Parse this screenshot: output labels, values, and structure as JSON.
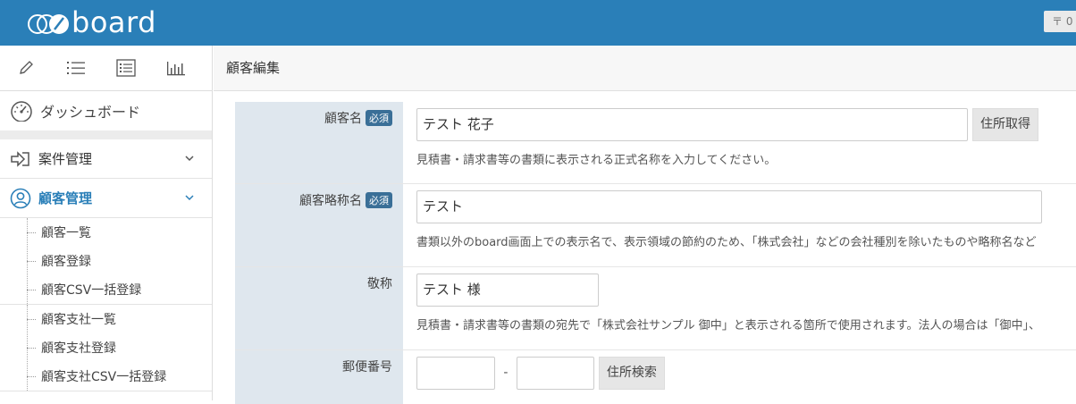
{
  "header": {
    "logo_text": "board",
    "notif_label": "〒 0"
  },
  "sidebar": {
    "toolbar_icons": [
      "pencil-icon",
      "list-icon",
      "list-box-icon",
      "chart-icon"
    ],
    "dashboard_label": "ダッシュボード",
    "case_menu_label": "案件管理",
    "customer_menu_label": "顧客管理",
    "customer_items": [
      "顧客一覧",
      "顧客登録",
      "顧客CSV一括登録"
    ],
    "payer_items": [
      "顧客支社一覧",
      "顧客支社登録",
      "顧客支社CSV一括登録"
    ]
  },
  "main": {
    "title": "顧客編集",
    "required_badge": "必須",
    "fields": {
      "name": {
        "label": "顧客名",
        "value": "テスト 花子",
        "button": "住所取得",
        "help": "見積書・請求書等の書類に表示される正式名称を入力してください。"
      },
      "short_name": {
        "label": "顧客略称名",
        "value": "テスト",
        "help": "書類以外のboard画面上での表示名で、表示領域の節約のため、「株式会社」などの会社種別を除いたものや略称名など"
      },
      "honorific": {
        "label": "敬称",
        "value": "テスト 様",
        "help": "見積書・請求書等の書類の宛先で「株式会社サンプル 御中」と表示される箇所で使用されます。法人の場合は「御中」、"
      },
      "postal": {
        "label": "郵便番号",
        "value1": "",
        "separator": "-",
        "value2": "",
        "button": "住所検索"
      }
    }
  },
  "colors": {
    "header_bg": "#2a7fb8",
    "label_bg": "#dfe7ee",
    "badge_bg": "#3a6f97",
    "active_menu": "#2a7fb8"
  }
}
